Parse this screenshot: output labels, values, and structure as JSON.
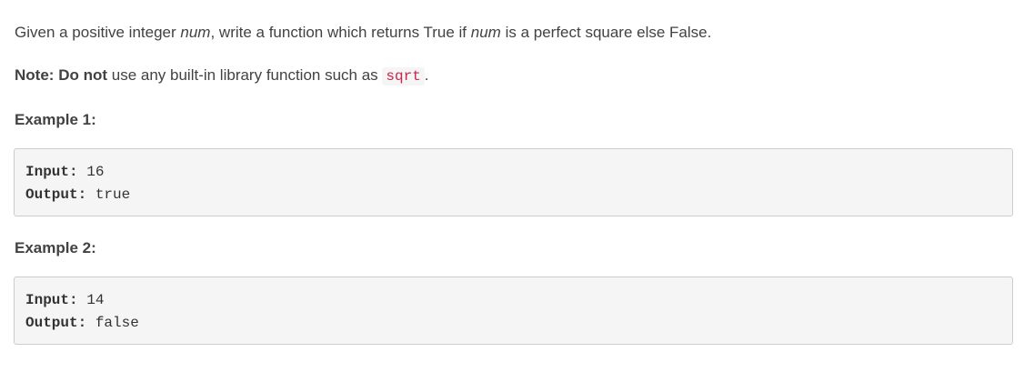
{
  "problem": {
    "sentence": {
      "part1": "Given a positive integer ",
      "var1": "num",
      "part2": ", write a function which returns True if ",
      "var2": "num",
      "part3": " is a perfect square else False."
    },
    "note": {
      "label": "Note:",
      "emphasis": "Do not",
      "text": " use any built-in library function such as ",
      "code": "sqrt",
      "end": "."
    }
  },
  "examples": [
    {
      "heading": "Example 1:",
      "input_label": "Input:",
      "input_value": "16",
      "output_label": "Output:",
      "output_value": "true"
    },
    {
      "heading": "Example 2:",
      "input_label": "Input:",
      "input_value": "14",
      "output_label": "Output:",
      "output_value": "false"
    }
  ]
}
